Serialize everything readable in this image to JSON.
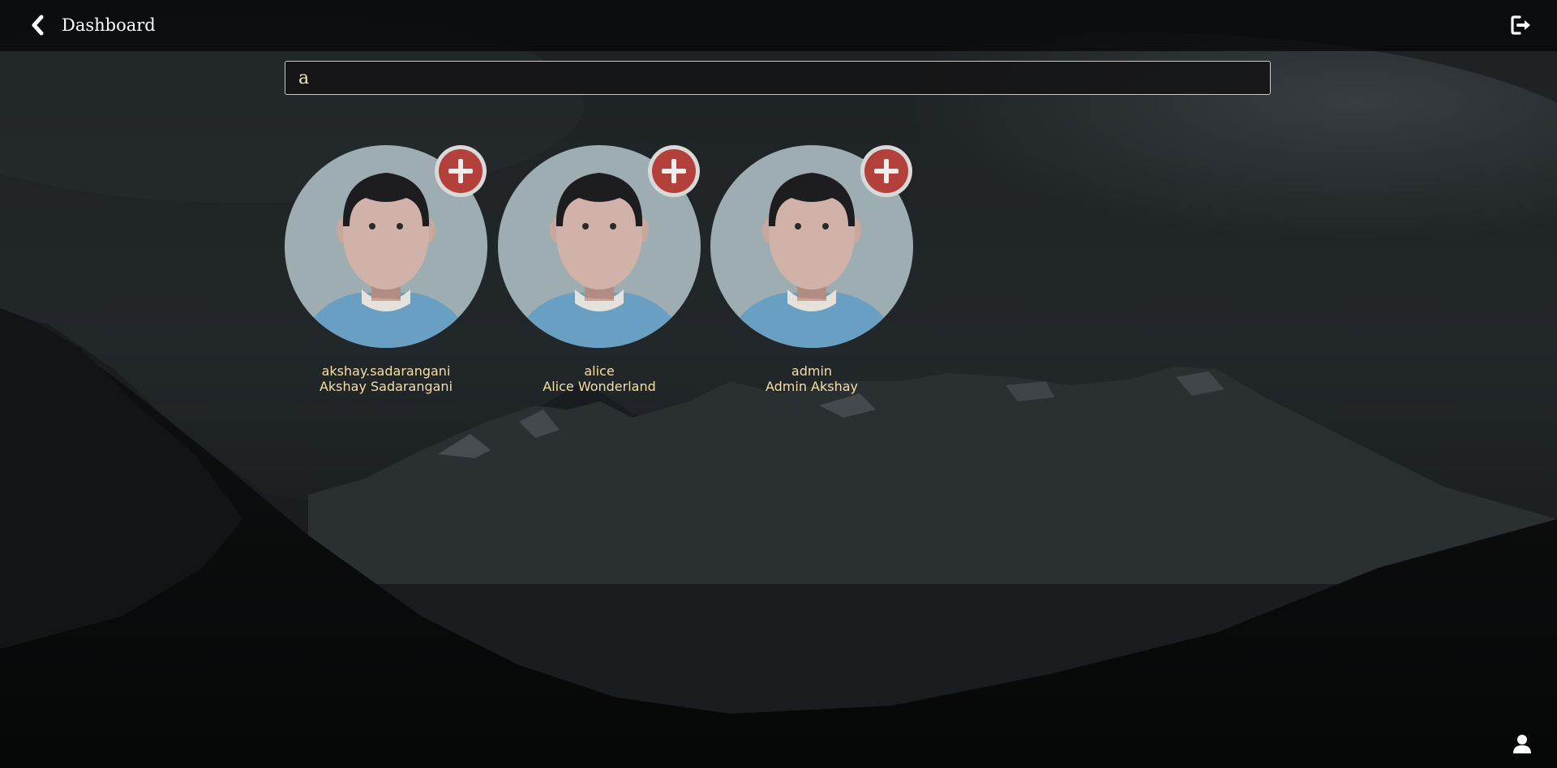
{
  "header": {
    "title": "Dashboard",
    "back_icon": "chevron-left-icon",
    "logout_icon": "sign-out-icon"
  },
  "search": {
    "value": "a"
  },
  "users": [
    {
      "username": "akshay.sadarangani",
      "full_name": "Akshay Sadarangani"
    },
    {
      "username": "alice",
      "full_name": "Alice Wonderland"
    },
    {
      "username": "admin",
      "full_name": "Admin Akshay"
    }
  ],
  "footer": {
    "profile_icon": "user-icon"
  },
  "colors": {
    "accent_red": "#b3403a",
    "name_text": "#f5dfa8",
    "avatar_bg": "#9eadb2",
    "shirt": "#6a9fc4"
  }
}
